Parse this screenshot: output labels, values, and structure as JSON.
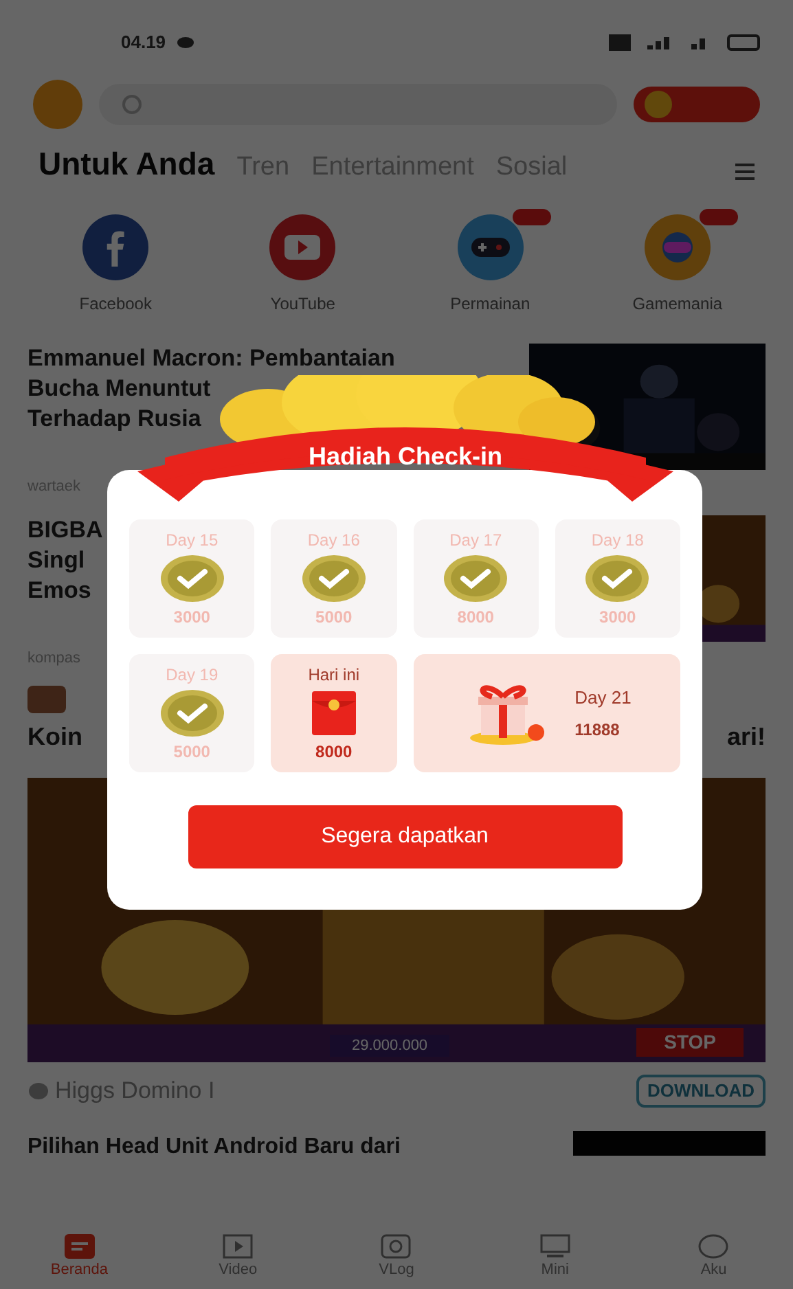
{
  "status_bar": {
    "time": "04.19"
  },
  "tabs": [
    {
      "label": "Untuk Anda",
      "selected": true
    },
    {
      "label": "Tren",
      "selected": false
    },
    {
      "label": "Entertainment",
      "selected": false
    },
    {
      "label": "Sosial",
      "selected": false
    }
  ],
  "shortcuts": [
    {
      "label": "Facebook",
      "kind": "facebook",
      "badge": false
    },
    {
      "label": "YouTube",
      "kind": "youtube",
      "badge": false
    },
    {
      "label": "Permainan",
      "kind": "game",
      "badge": true
    },
    {
      "label": "Gamemania",
      "kind": "mania",
      "badge": true
    }
  ],
  "feed": [
    {
      "kind": "news",
      "lines": [
        "Emmanuel Macron: Pembantaian",
        "Bucha Menuntut",
        "Terhadap Rusia"
      ],
      "source": "wartaek"
    },
    {
      "kind": "news",
      "lines": [
        "BIGBA",
        "Singl",
        "Emos"
      ],
      "source": "kompas"
    },
    {
      "kind": "promo",
      "left": "Koin",
      "right": "ari!"
    },
    {
      "kind": "ad",
      "name": "Higgs Domino I",
      "action": "DOWNLOAD",
      "banner": "29.000.000",
      "stop": "STOP"
    },
    {
      "kind": "headline",
      "text": "Pilihan Head Unit Android Baru dari"
    }
  ],
  "bottom_nav": [
    {
      "label": "Beranda",
      "selected": true
    },
    {
      "label": "Video",
      "selected": false
    },
    {
      "label": "VLog",
      "selected": false
    },
    {
      "label": "Mini",
      "selected": false
    },
    {
      "label": "Aku",
      "selected": false
    }
  ],
  "dialog": {
    "title": "Hadiah Check-in",
    "days": [
      {
        "kind": "claimed",
        "label": "Day 15",
        "amount": "3000"
      },
      {
        "kind": "claimed",
        "label": "Day 16",
        "amount": "5000"
      },
      {
        "kind": "claimed",
        "label": "Day 17",
        "amount": "8000"
      },
      {
        "kind": "claimed",
        "label": "Day 18",
        "amount": "3000"
      },
      {
        "kind": "claimed",
        "label": "Day 19",
        "amount": "5000"
      },
      {
        "kind": "today",
        "label": "Hari ini",
        "amount": "8000"
      },
      {
        "kind": "grand",
        "label": "Day 21",
        "amount": "11888"
      }
    ],
    "button": "Segera dapatkan"
  }
}
